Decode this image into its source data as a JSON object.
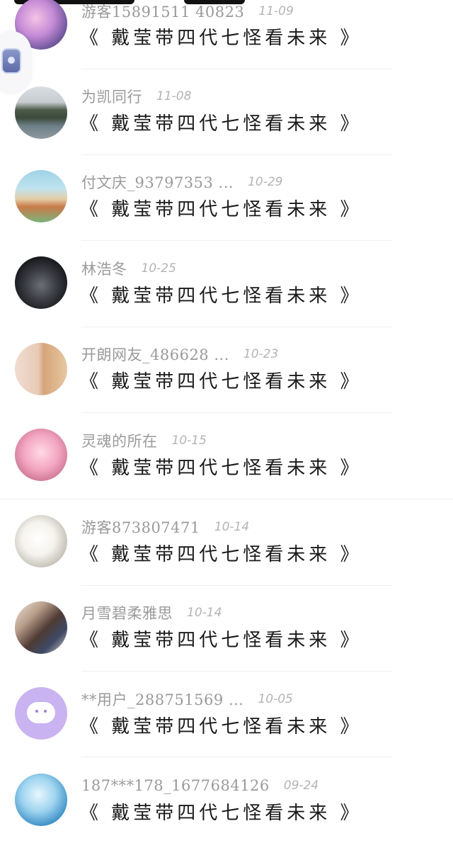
{
  "floating_widget": {
    "icon": "app-shortcut-icon"
  },
  "comments": [
    {
      "user": "游客15891511 40823",
      "date": "11-09",
      "text": "《 戴莹带四代七怪看未来 》",
      "avatar": "anime-girl-avatar"
    },
    {
      "user": "为凯同行",
      "date": "11-08",
      "text": "《 戴莹带四代七怪看未来 》",
      "avatar": "lake-photo-avatar"
    },
    {
      "user": "付文庆_93797353 ...",
      "date": "10-29",
      "text": "《 戴莹带四代七怪看未来 》",
      "avatar": "park-avatar"
    },
    {
      "user": "林浩冬",
      "date": "10-25",
      "text": "《 戴莹带四代七怪看未来 》",
      "avatar": "car-interior-avatar"
    },
    {
      "user": "开朗网友_486628 ...",
      "date": "10-23",
      "text": "《 戴莹带四代七怪看未来 》",
      "avatar": "person-with-bear-avatar"
    },
    {
      "user": "灵魂的所在",
      "date": "10-15",
      "text": "《 戴莹带四代七怪看未来 》",
      "avatar": "pink-anime-avatar"
    },
    {
      "user": "游客873807471",
      "date": "10-14",
      "text": "《 戴莹带四代七怪看未来 》",
      "avatar": "ice-bear-avatar"
    },
    {
      "user": "月雪碧柔雅思",
      "date": "10-14",
      "text": "《 戴莹带四代七怪看未来 》",
      "avatar": "photo-collage-avatar"
    },
    {
      "user": "**用户_288751569 ...",
      "date": "10-05",
      "text": "《 戴莹带四代七怪看未来 》",
      "avatar": "default-chat-avatar"
    },
    {
      "user": "187***178_1677684126",
      "date": "09-24",
      "text": "《 戴莹带四代七怪看未来 》",
      "avatar": "mermaid-avatar"
    }
  ]
}
